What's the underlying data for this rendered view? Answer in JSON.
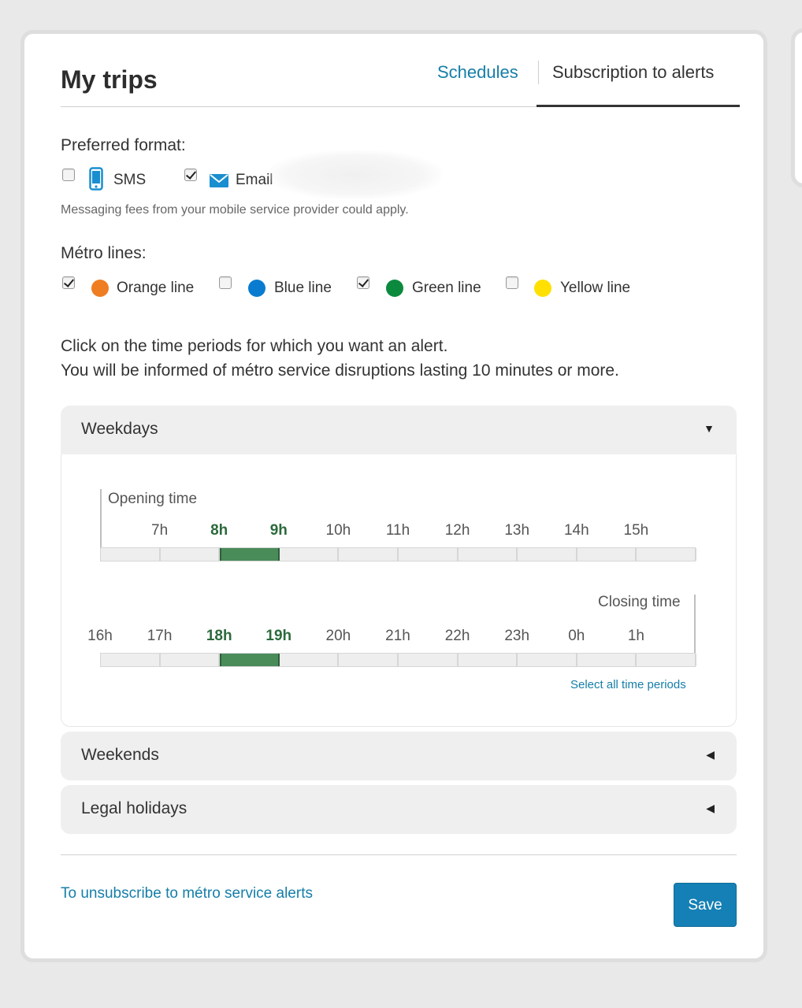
{
  "header": {
    "title": "My trips",
    "tabs": [
      {
        "label": "Schedules"
      },
      {
        "label": "Subscription to alerts"
      }
    ]
  },
  "format": {
    "label": "Preferred format:",
    "options": [
      {
        "label": "SMS",
        "checked": false,
        "icon": "phone-icon"
      },
      {
        "label": "Email",
        "checked": true,
        "icon": "envelope-icon"
      }
    ],
    "note": "Messaging fees from your mobile service provider could apply."
  },
  "lines": {
    "label": "Métro lines:",
    "items": [
      {
        "label": "Orange line",
        "checked": true,
        "color": "#ef7d22"
      },
      {
        "label": "Blue line",
        "checked": false,
        "color": "#0a7ccf"
      },
      {
        "label": "Green line",
        "checked": true,
        "color": "#0b8a3e"
      },
      {
        "label": "Yellow line",
        "checked": false,
        "color": "#ffe000"
      }
    ]
  },
  "instructions": {
    "line1": "Click on the time periods for which you want an alert.",
    "line2": "You will be informed of métro service disruptions lasting 10 minutes or more."
  },
  "weekdays": {
    "title": "Weekdays",
    "opening_label": "Opening time",
    "closing_label": "Closing time",
    "row1_ticks": [
      "7h",
      "8h",
      "9h",
      "10h",
      "11h",
      "12h",
      "13h",
      "14h",
      "15h"
    ],
    "row1_selected": [
      "8h",
      "9h"
    ],
    "row2_ticks": [
      "16h",
      "17h",
      "18h",
      "19h",
      "20h",
      "21h",
      "22h",
      "23h",
      "0h",
      "1h"
    ],
    "row2_selected": [
      "18h",
      "19h"
    ],
    "select_all": "Select all time periods"
  },
  "weekends": {
    "title": "Weekends"
  },
  "holidays": {
    "title": "Legal holidays"
  },
  "footer": {
    "unsubscribe": "To unsubscribe to métro service alerts",
    "save": "Save"
  }
}
